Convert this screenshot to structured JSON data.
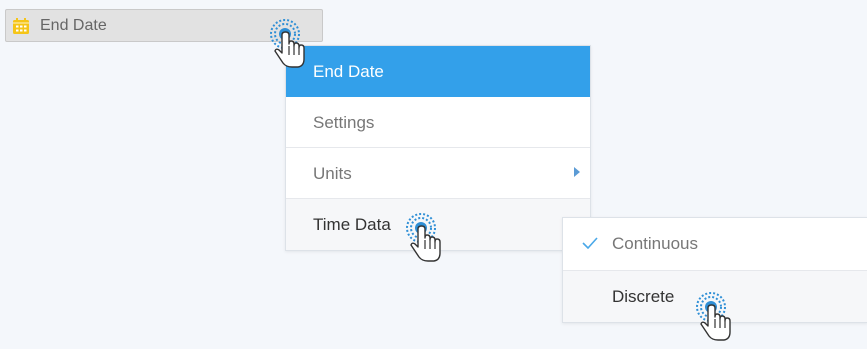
{
  "field": {
    "label": "End Date",
    "icon": "calendar-icon"
  },
  "menu": {
    "items": [
      {
        "label": "End Date",
        "state": "active"
      },
      {
        "label": "Settings"
      },
      {
        "label": "Units",
        "has_submenu": true
      },
      {
        "label": "Time Data",
        "state": "hovered"
      }
    ]
  },
  "submenu": {
    "items": [
      {
        "label": "Continuous",
        "checked": true
      },
      {
        "label": "Discrete",
        "state": "hovered"
      }
    ]
  },
  "colors": {
    "accent": "#33a0ea",
    "calendar_icon": "#f5c518",
    "pointer_ring": "#2f8fd6"
  }
}
